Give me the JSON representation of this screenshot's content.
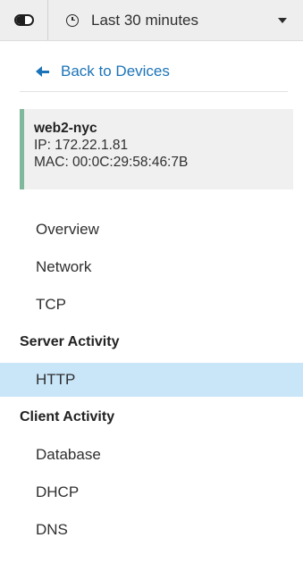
{
  "toolbar": {
    "toggle_icon": "toggle-icon",
    "time_icon": "clock-icon",
    "time_range_label": "Last 30 minutes",
    "dropdown_icon": "caret-down-icon"
  },
  "back_link": {
    "icon": "arrow-left-icon",
    "label": "Back to Devices"
  },
  "device": {
    "name": "web2-nyc",
    "ip": "IP: 172.22.1.81",
    "mac": "MAC: 00:0C:29:58:46:7B",
    "accent_color": "#7fb89a"
  },
  "nav": {
    "items": [
      {
        "label": "Overview"
      },
      {
        "label": "Network"
      },
      {
        "label": "TCP"
      }
    ],
    "sections": [
      {
        "title": "Server Activity",
        "items": [
          {
            "label": "HTTP",
            "active": true
          }
        ]
      },
      {
        "title": "Client Activity",
        "items": [
          {
            "label": "Database"
          },
          {
            "label": "DHCP"
          },
          {
            "label": "DNS"
          }
        ]
      }
    ]
  },
  "colors": {
    "link": "#1c74b8",
    "active_bg": "#c9e6f9",
    "toolbar_bg": "#eeeeee",
    "card_bg": "#f0f0f0"
  }
}
